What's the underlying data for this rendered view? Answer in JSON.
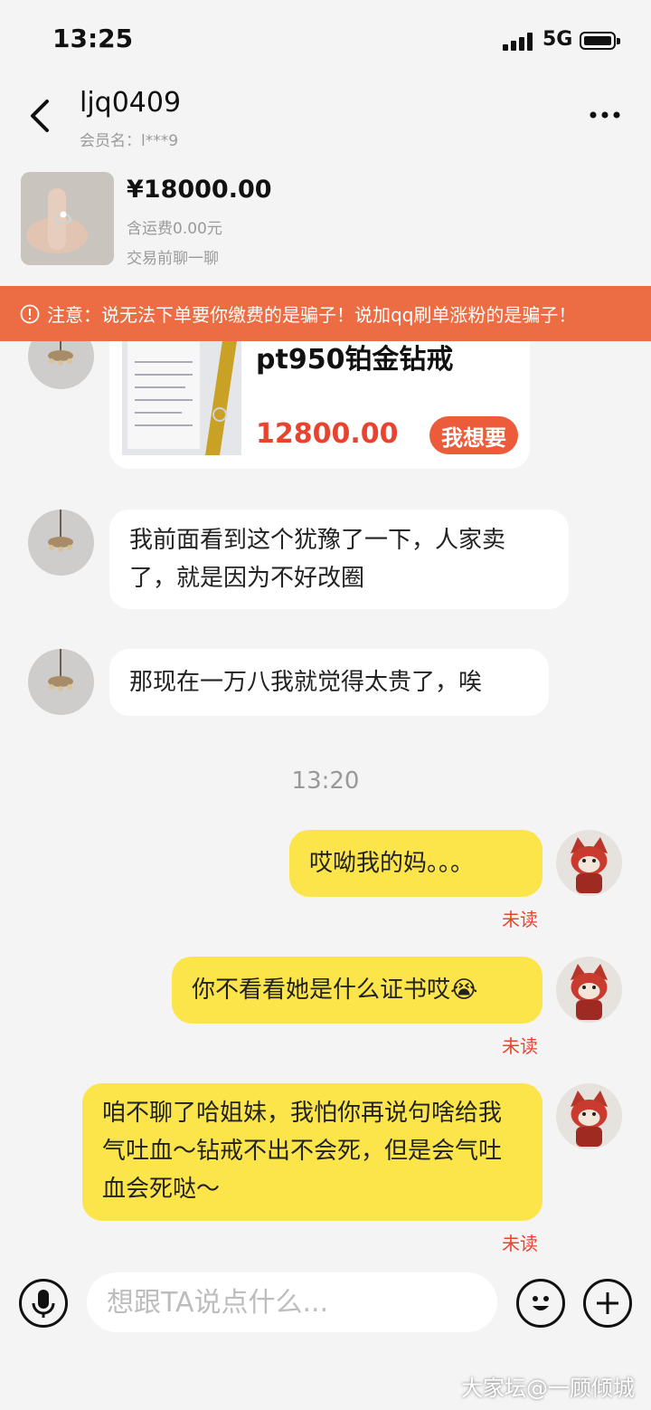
{
  "status_bar": {
    "time": "13:25",
    "network": "5G"
  },
  "header": {
    "title": "ljq0409",
    "subtitle": "会员名：l***9"
  },
  "product": {
    "price": "¥18000.00",
    "shipping": "含运费0.00元",
    "hint": "交易前聊一聊"
  },
  "warning": {
    "text": "注意：说无法下单要你缴费的是骗子！说加qq刷单涨粉的是骗子！"
  },
  "shared_item": {
    "name": "pt950铂金钻戒",
    "price": "12800.00",
    "action_label": "我想要"
  },
  "messages": [
    {
      "from": "other",
      "text": "我前面看到这个犹豫了一下，人家卖了，就是因为不好改圈"
    },
    {
      "from": "other",
      "text": "那现在一万八我就觉得太贵了，唉"
    },
    {
      "from": "self",
      "text": "哎呦我的妈。。。",
      "status": "未读"
    },
    {
      "from": "self",
      "text": "你不看看她是什么证书哎",
      "emoji": "😭",
      "status": "未读"
    },
    {
      "from": "self",
      "text": "咱不聊了哈姐妹，我怕你再说句啥给我气吐血～钻戒不出不会死，但是会气吐血会死哒～",
      "status": "未读"
    }
  ],
  "time_divider": "13:20",
  "input": {
    "placeholder": "想跟TA说点什么..."
  },
  "watermark": "大家坛@一顾倾城",
  "colors": {
    "accent": "#ec6c43",
    "price_red": "#e8432e",
    "self_bubble": "#fbe54b",
    "unread": "#e8432e"
  },
  "icons": [
    "back-arrow-icon",
    "more-dots-icon",
    "warning-circle-icon",
    "microphone-icon",
    "smiley-icon",
    "plus-icon",
    "signal-icon",
    "battery-icon"
  ]
}
